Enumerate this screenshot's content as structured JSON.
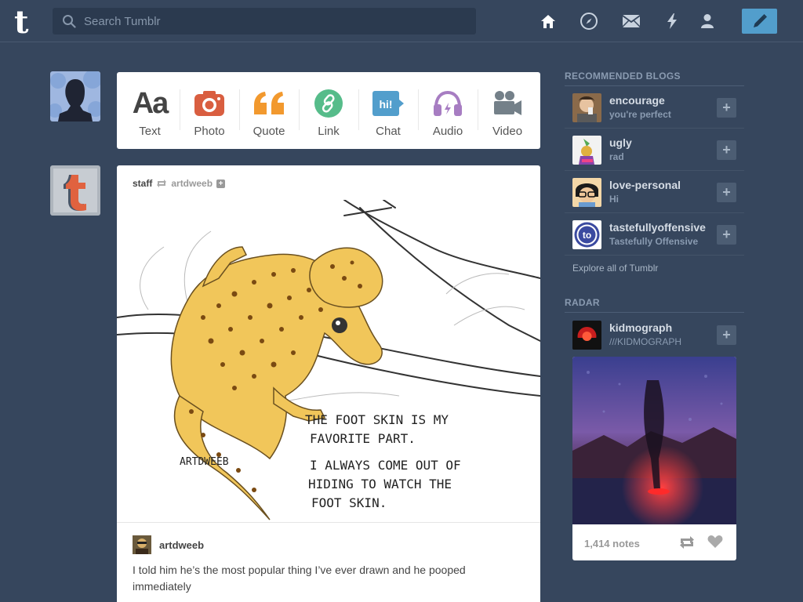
{
  "header": {
    "logo_letter": "t",
    "search_placeholder": "Search Tumblr",
    "nav_icons": [
      "home-icon",
      "explore-compass-icon",
      "inbox-mail-icon",
      "activity-lightning-icon",
      "account-person-icon"
    ],
    "compose_icon": "pencil-icon"
  },
  "post_types": [
    {
      "label": "Text",
      "icon": "text-aa-icon",
      "color": "#444444",
      "glyph": "Aa"
    },
    {
      "label": "Photo",
      "icon": "camera-icon",
      "color": "#d95e40"
    },
    {
      "label": "Quote",
      "icon": "quote-icon",
      "color": "#f2992e"
    },
    {
      "label": "Link",
      "icon": "link-icon",
      "color": "#56bc8a"
    },
    {
      "label": "Chat",
      "icon": "chat-bubble-icon",
      "color": "#529ecc",
      "glyph": "hi!"
    },
    {
      "label": "Audio",
      "icon": "headphones-icon",
      "color": "#a77dc2"
    },
    {
      "label": "Video",
      "icon": "video-camera-icon",
      "color": "#748089"
    }
  ],
  "post": {
    "author": "staff",
    "reblog_icon": "reblog-icon",
    "reblogged_from": "artdweeb",
    "art_text_lines": [
      "THE FOOT SKIN IS MY",
      "FAVORITE PART.",
      "I ALWAYS COME OUT OF",
      "HIDING TO WATCH THE",
      "FOOT SKIN."
    ],
    "art_signature": "ARTDWEEB",
    "caption_author": "artdweeb",
    "caption": "I told him he’s the most popular thing I’ve ever drawn and he pooped immediately"
  },
  "sidebar": {
    "recommended_title": "RECOMMENDED BLOGS",
    "blogs": [
      {
        "name": "encourage",
        "subtitle": "you're perfect"
      },
      {
        "name": "ugly",
        "subtitle": "rad"
      },
      {
        "name": "love-personal",
        "subtitle": "Hi"
      },
      {
        "name": "tastefullyoffensive",
        "subtitle": "Tastefully Offensive",
        "avatar_text": "to"
      }
    ],
    "explore_link": "Explore all of Tumblr",
    "radar_title": "RADAR",
    "radar": {
      "name": "kidmograph",
      "subtitle": "///KIDMOGRAPH",
      "notes": "1,414 notes"
    }
  },
  "colors": {
    "background": "#36465d",
    "accent": "#529ecc",
    "search_bg": "#2b3a4f"
  }
}
